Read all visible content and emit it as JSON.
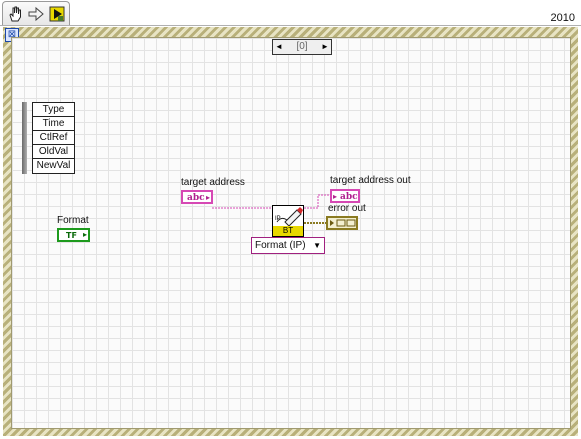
{
  "toolbar": {
    "tools": [
      {
        "name": "operate-tool-icon",
        "glyph": "✋"
      },
      {
        "name": "arrow-tool-icon",
        "glyph": "⇨"
      },
      {
        "name": "run-icon",
        "glyph": "▶"
      }
    ],
    "version": "2010"
  },
  "structure": {
    "case_selector_value": "[0]",
    "left_arrow": "◄",
    "right_arrow": "►",
    "select_icon": "⊠"
  },
  "event_node": {
    "items": [
      "Type",
      "Time",
      "CtlRef",
      "OldVal",
      "NewVal"
    ]
  },
  "nodes": {
    "target_address_label": "target address",
    "target_address_badge": "abc",
    "target_address_out_label": "target address out",
    "target_address_out_badge": "abc",
    "error_out_label": "error out",
    "format_label": "Format",
    "format_badge": "TF",
    "subvi_band": "BT",
    "subvi_tag": "IP",
    "format_ring_value": "Format (IP)",
    "format_ring_arrow": "▼"
  },
  "colors": {
    "string_wire": "#d648b4",
    "error_wire": "#8a7a20",
    "boolean": "#1d9a1d",
    "grid": "#e3e3e3",
    "frame_stripe": "#b8b07a"
  }
}
